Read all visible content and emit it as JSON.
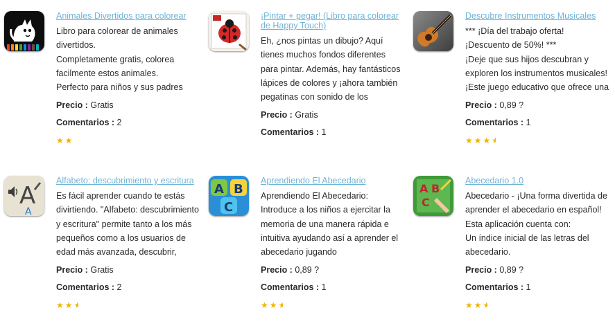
{
  "apps": [
    {
      "title": "Animales Divertidos para colorear",
      "icon": "cat-coloring-icon",
      "description_lines": [
        "Libro para colorear de animales",
        "divertidos.",
        "Completamente gratis, colorea",
        "facilmente estos animales.",
        "Perfecto para niños y sus padres"
      ],
      "price_label": "Precio :",
      "price_value": "Gratis",
      "comments_label": "Comentarios :",
      "comments_value": "2",
      "rating": 2
    },
    {
      "title_lines": [
        "¡Pintar + pegar! (Libro para colorear",
        "de Happy Touch)"
      ],
      "icon": "ladybug-icon",
      "description_lines": [
        "Eh, ¿nos pintas un dibujo? Aquí",
        "tienes muchos fondos diferentes",
        "para pintar. Además, hay fantásticos",
        "lápices de colores y ¡ahora también",
        "pegatinas con sonido de los"
      ],
      "price_label": "Precio :",
      "price_value": "Gratis",
      "comments_label": "Comentarios :",
      "comments_value": "1",
      "rating": 0
    },
    {
      "title": "Descubre Instrumentos Musicales",
      "icon": "guitar-icon",
      "description_lines": [
        "*** ¡Día del trabajo oferta!",
        "¡Descuento de 50%! ***",
        "¡Deje que sus hijos descubran y",
        "exploren los instrumentos musicales!",
        "¡Este juego educativo que ofrece una"
      ],
      "price_label": "Precio :",
      "price_value": "0,89 ?",
      "comments_label": "Comentarios :",
      "comments_value": "1",
      "rating": 3.5
    },
    {
      "title": "Alfabeto: descubrimiento y escritura",
      "icon": "alphabet-speaker-icon",
      "description_lines": [
        "Es fácil aprender cuando te estás",
        "divirtiendo. \"Alfabeto: descubrimiento",
        "y escritura\" permite tanto a los más",
        "pequeños como a los usuarios de",
        "edad más avanzada, descubrir,"
      ],
      "price_label": "Precio :",
      "price_value": "Gratis",
      "comments_label": "Comentarios :",
      "comments_value": "2",
      "rating": 2.5
    },
    {
      "title": "Aprendiendo El Abecedario",
      "icon": "abc-blocks-icon",
      "description_lines": [
        "Aprendiendo El Abecedario:",
        "Introduce a los niños a ejercitar la",
        "memoria de una manera rápida e",
        "intuitiva ayudando así a aprender el",
        "abecedario jugando"
      ],
      "price_label": "Precio :",
      "price_value": "0,89 ?",
      "comments_label": "Comentarios :",
      "comments_value": "1",
      "rating": 2.5
    },
    {
      "title": "Abecedario 1.0",
      "icon": "abc-writing-icon",
      "description_lines": [
        "Abecedario - ¡Una forma divertida de",
        "aprender el abecedario en español!",
        "Esta aplicación cuenta con:",
        "Un índice inicial de las letras del",
        "abecedario."
      ],
      "price_label": "Precio :",
      "price_value": "0,89 ?",
      "comments_label": "Comentarios :",
      "comments_value": "1",
      "rating": 2.5
    }
  ],
  "colors": {
    "link": "#6fb3d6",
    "text": "#2b2b2b",
    "star": "#f0b400"
  }
}
